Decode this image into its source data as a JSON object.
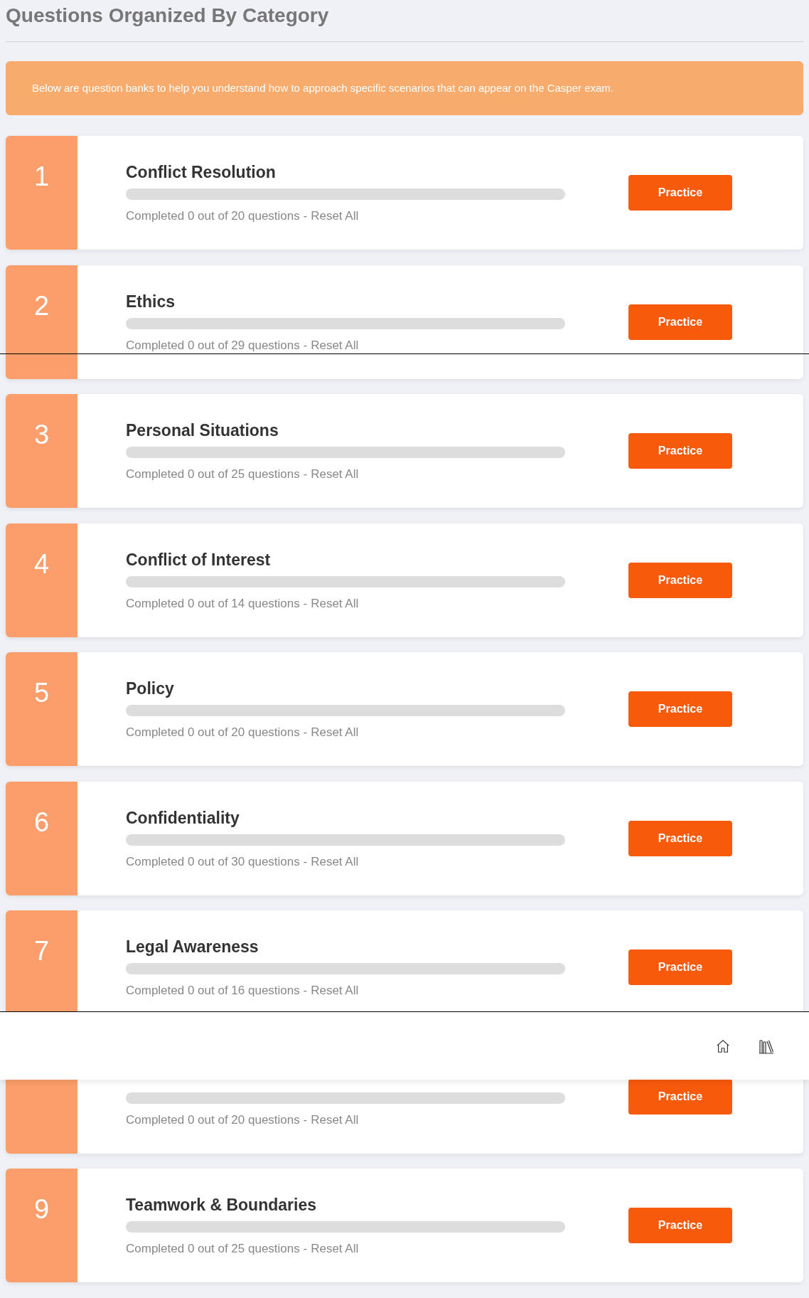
{
  "page_title": "Questions Organized By Category",
  "banner": "Below are question banks to help you understand how to approach specific scenarios that can appear on the Casper exam.",
  "categories": [
    {
      "number": "1",
      "title": "Conflict Resolution",
      "level": 0,
      "progress": "Completed 0 out of 20 questions -",
      "reset": "Reset All",
      "button": "Practice"
    },
    {
      "number": "2",
      "title": "Ethics",
      "level": 0,
      "progress": "Completed 0 out of 29 questions -",
      "reset": "Reset All",
      "button": "Practice"
    },
    {
      "number": "3",
      "title": "Personal Situations",
      "level": 0,
      "progress": "Completed 0 out of 25 questions -",
      "reset": "Reset All",
      "button": "Practice"
    },
    {
      "number": "4",
      "title": "Conflict of Interest",
      "level": 0,
      "progress": "Completed 0 out of 14 questions -",
      "reset": "Reset All",
      "button": "Practice"
    },
    {
      "number": "5",
      "title": "Policy",
      "level": 0,
      "progress": "Completed 0 out of 20 questions -",
      "reset": "Reset All",
      "button": "Practice"
    },
    {
      "number": "6",
      "title": "Confidentiality",
      "level": 0,
      "progress": "Completed 0 out of 30 questions -",
      "reset": "Reset All",
      "button": "Practice"
    },
    {
      "number": "7",
      "title": "Legal Awareness",
      "level": 0,
      "progress": "Completed 0 out of 16 questions -",
      "reset": "Reset All",
      "button": "Practice"
    },
    {
      "level": 0,
      "progress": "Completed 0 out of 20 questions -",
      "reset": "Reset All",
      "button": "Practice"
    },
    {
      "number": "9",
      "title": "Teamwork & Boundaries",
      "level": 0,
      "progress": "Completed 0 out of 25 questions -",
      "reset": "Reset All",
      "button": "Practice"
    }
  ]
}
